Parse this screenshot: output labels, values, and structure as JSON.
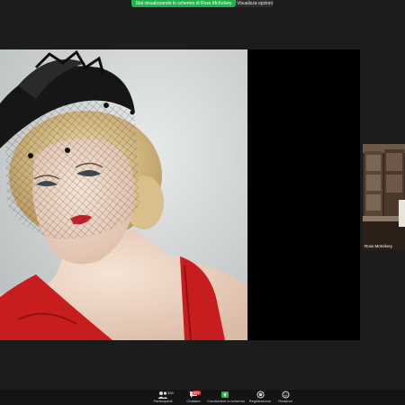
{
  "banner": {
    "sharing_text": "Stai visualizzando lo schermo di Ross McKelvey",
    "view_options": "Visualizza opzioni"
  },
  "participant": {
    "name": "Ross McKelvey"
  },
  "toolbar": {
    "participants_label": "Partecipanti",
    "participants_count": "358",
    "chat_label": "Chattare",
    "chat_badge": "99+",
    "share_label": "Condividere lo schermo",
    "record_label": "Registrazione",
    "reactions_label": "Reazioni"
  },
  "colors": {
    "share_green": "#1fb44a",
    "badge_red": "#e23a3a",
    "dress_red": "#c81d1e"
  },
  "icons": [
    "people-icon",
    "chat-icon",
    "share-screen-icon",
    "record-icon",
    "reactions-icon"
  ]
}
